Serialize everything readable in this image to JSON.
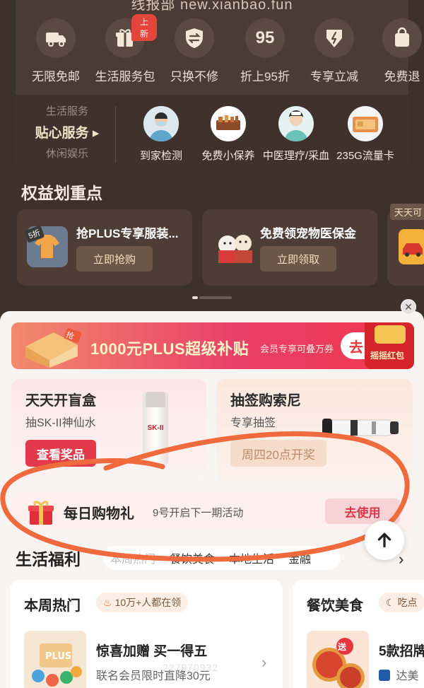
{
  "header": {
    "partial_url": "线报部 new.xianbao.fun"
  },
  "perks": [
    {
      "label": "无限免邮",
      "icon": "truck-icon",
      "badge": ""
    },
    {
      "label": "生活服务包",
      "icon": "gift-icon",
      "badge": "上新"
    },
    {
      "label": "只换不修",
      "icon": "exchange-shield-icon",
      "badge": ""
    },
    {
      "label": "折上95折",
      "icon": "95-icon",
      "badge": ""
    },
    {
      "label": "专享立减",
      "icon": "discount-icon",
      "badge": ""
    },
    {
      "label": "免费退",
      "icon": "return-bag-icon",
      "badge": ""
    }
  ],
  "services": {
    "left_top": "生活服务",
    "left_main": "贴心服务 ▸",
    "left_bottom": "休闲娱乐",
    "items": [
      {
        "label": "到家检测",
        "icon": "doctor-avatar"
      },
      {
        "label": "免费小保养",
        "icon": "tools-avatar"
      },
      {
        "label": "中医理疗/采血",
        "icon": "nurse-avatar"
      },
      {
        "label": "235G流量卡",
        "icon": "sim-card-avatar"
      }
    ]
  },
  "benefits": {
    "title": "权益划重点",
    "cards": [
      {
        "title": "抢PLUS专享服装...",
        "button": "立即抢购",
        "badge": "5折"
      },
      {
        "title": "免费领宠物医保金",
        "button": "立即领取"
      },
      {
        "title": "天天可"
      }
    ]
  },
  "banner": {
    "title": "1000元PLUS超级补贴",
    "subtitle": "会员专享可叠万券",
    "button": "去",
    "decor_text": "摇摇红包"
  },
  "tiles": [
    {
      "title": "天天开盲盒",
      "subtitle": "抽SK-II神仙水",
      "button": "查看奖品",
      "product": "SK-II"
    },
    {
      "title": "抽签购索尼",
      "subtitle": "专享抽签",
      "button": "周四20点开奖"
    }
  ],
  "daily_gift": {
    "title": "每日购物礼",
    "subtitle": "9号开启下一期活动",
    "button": "去使用"
  },
  "life": {
    "title": "生活福利",
    "tabs": [
      "本周热门",
      "餐饮美食",
      "本地生活",
      "金融"
    ]
  },
  "bottom_cards": [
    {
      "title": "本周热门",
      "tag": "10万+人都在领",
      "item_name": "惊喜加赠 买一得五",
      "item_desc": "联名会员限时直降30元"
    },
    {
      "title": "餐饮美食",
      "tag": "吃点",
      "item_name": "5款招牌",
      "item_desc": "达美",
      "thumb_badge": "送"
    }
  ],
  "watermark": "227970932",
  "colors": {
    "dark_bg": "#3d312c",
    "accent_gold": "#f1e2c8",
    "brand_red": "#e23a3a",
    "annotation": "#ef6a3d"
  }
}
